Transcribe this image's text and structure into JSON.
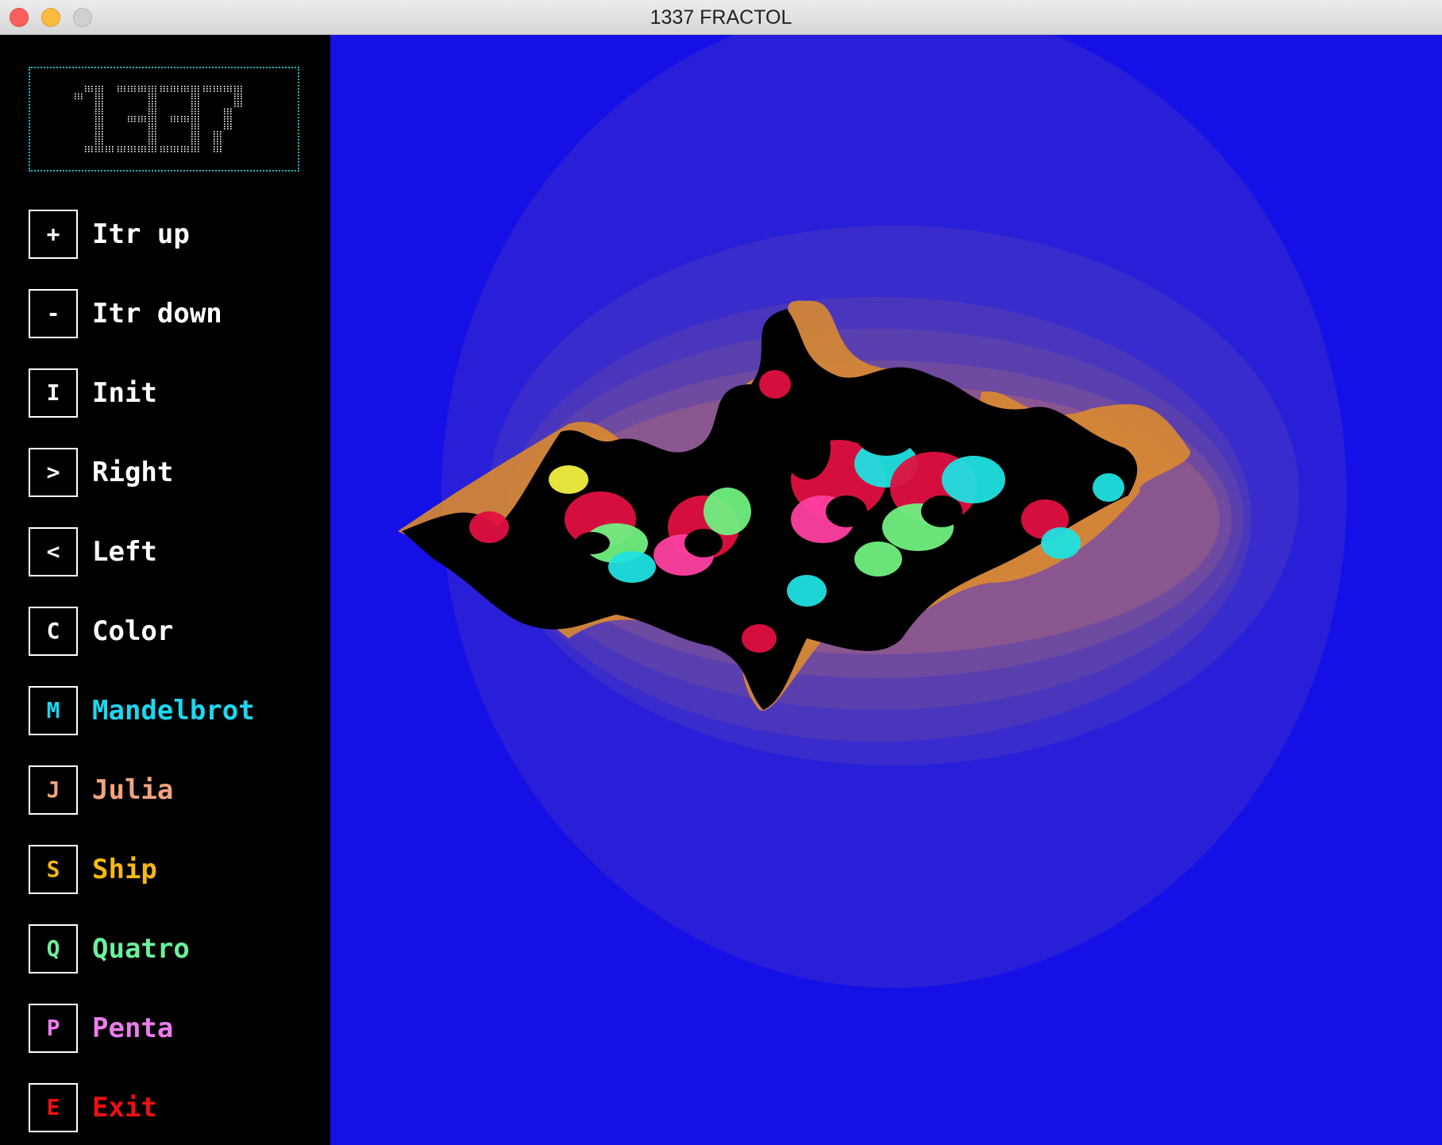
{
  "window": {
    "title": "1337 FRACTOL"
  },
  "logo": {
    "text": "1337",
    "border_color": "#1fb9c6",
    "dot_color": "#ffffff"
  },
  "menu": [
    {
      "key": "+",
      "label": "Itr up",
      "color": "#ffffff"
    },
    {
      "key": "-",
      "label": "Itr down",
      "color": "#ffffff"
    },
    {
      "key": "I",
      "label": "Init",
      "color": "#ffffff"
    },
    {
      "key": ">",
      "label": "Right",
      "color": "#ffffff"
    },
    {
      "key": "<",
      "label": "Left",
      "color": "#ffffff"
    },
    {
      "key": "C",
      "label": "Color",
      "color": "#ffffff"
    },
    {
      "key": "M",
      "label": "Mandelbrot",
      "color": "#1ed6f0"
    },
    {
      "key": "J",
      "label": "Julia",
      "color": "#f2a37e"
    },
    {
      "key": "S",
      "label": "Ship",
      "color": "#f5b815"
    },
    {
      "key": "Q",
      "label": "Quatro",
      "color": "#6df09a"
    },
    {
      "key": "P",
      "label": "Penta",
      "color": "#ec7cec"
    },
    {
      "key": "E",
      "label": "Exit",
      "color": "#ee1010"
    }
  ],
  "fractal": {
    "type": "Julia",
    "background_color": "#1511e6",
    "set_color": "#000000",
    "palette": [
      "#2a1fd8",
      "#3a2ccc",
      "#4a36bd",
      "#5a3fae",
      "#6e4aa0",
      "#8a5690",
      "#b06a60",
      "#d98a30",
      "#f0a020",
      "#e01040",
      "#ff40a0",
      "#20e0e0",
      "#70f080",
      "#f0f040"
    ]
  }
}
